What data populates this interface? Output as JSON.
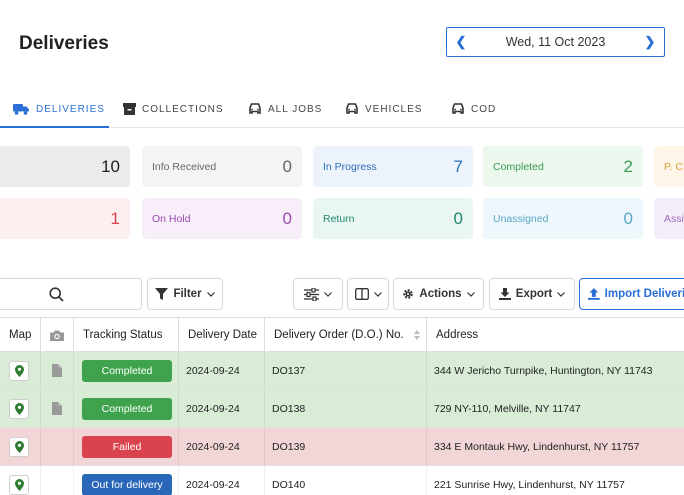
{
  "header": {
    "title": "Deliveries"
  },
  "date_picker": {
    "value": "Wed, 11 Oct 2023",
    "prev_icon": "chevron-left-icon",
    "next_icon": "chevron-right-icon"
  },
  "tabs": [
    {
      "label": "DELIVERIES",
      "icon": "truck-icon",
      "active": true
    },
    {
      "label": "COLLECTIONS",
      "icon": "box-icon",
      "active": false
    },
    {
      "label": "ALL JOBS",
      "icon": "car-icon",
      "active": false
    },
    {
      "label": "VEHICLES",
      "icon": "car-icon",
      "active": false
    },
    {
      "label": "COD",
      "icon": "car-icon",
      "active": false
    }
  ],
  "status_cards": {
    "row1": [
      {
        "label": "",
        "count": "10",
        "bg": "#ebebeb",
        "color": "#222222"
      },
      {
        "label": "Info Received",
        "count": "0",
        "bg": "#f4f4f4",
        "color": "#666666"
      },
      {
        "label": "In Progress",
        "count": "7",
        "bg": "#edf3fb",
        "color": "#2a6fb8"
      },
      {
        "label": "Completed",
        "count": "2",
        "bg": "#ecf7ee",
        "color": "#3a9a52"
      },
      {
        "label": "P. C",
        "count": "",
        "bg": "#fdf6e8",
        "color": "#d6a23a"
      }
    ],
    "row2": [
      {
        "label": "",
        "count": "1",
        "bg": "#fcefef",
        "color": "#d9434d"
      },
      {
        "label": "On Hold",
        "count": "0",
        "bg": "#f7eef9",
        "color": "#9b4bb3"
      },
      {
        "label": "Return",
        "count": "0",
        "bg": "#e9f6f2",
        "color": "#1f8a6f"
      },
      {
        "label": "Unassigned",
        "count": "0",
        "bg": "#eef7fb",
        "color": "#5aa6c7"
      },
      {
        "label": "Assi",
        "count": "",
        "bg": "#f5eefa",
        "color": "#9b6bb8"
      }
    ]
  },
  "toolbar": {
    "search_icon": "search-icon",
    "filter_label": "Filter",
    "actions_label": "Actions",
    "export_label": "Export",
    "import_label": "Import Deliveries"
  },
  "table": {
    "columns": [
      "Map",
      "",
      "Tracking Status",
      "Delivery Date",
      "Delivery Order (D.O.) No.",
      "Address"
    ],
    "rows": [
      {
        "status": "Completed",
        "status_color": "#3fa34d",
        "row_bg": "#d8ecd6",
        "date": "2024-09-24",
        "order": "DO137",
        "address": "344 W Jericho Turnpike, Huntington, NY 11743",
        "has_doc": true
      },
      {
        "status": "Completed",
        "status_color": "#3fa34d",
        "row_bg": "#d8ecd6",
        "date": "2024-09-24",
        "order": "DO138",
        "address": "729 NY-110, Melville, NY 11747",
        "has_doc": true
      },
      {
        "status": "Failed",
        "status_color": "#d9434d",
        "row_bg": "#f2d5d7",
        "date": "2024-09-24",
        "order": "DO139",
        "address": "334 E Montauk Hwy, Lindenhurst, NY 11757",
        "has_doc": false
      },
      {
        "status": "Out for delivery",
        "status_color": "#2b67b8",
        "row_bg": "#ffffff",
        "date": "2024-09-24",
        "order": "DO140",
        "address": "221 Sunrise Hwy, Lindenhurst, NY 11757",
        "has_doc": false
      }
    ]
  }
}
